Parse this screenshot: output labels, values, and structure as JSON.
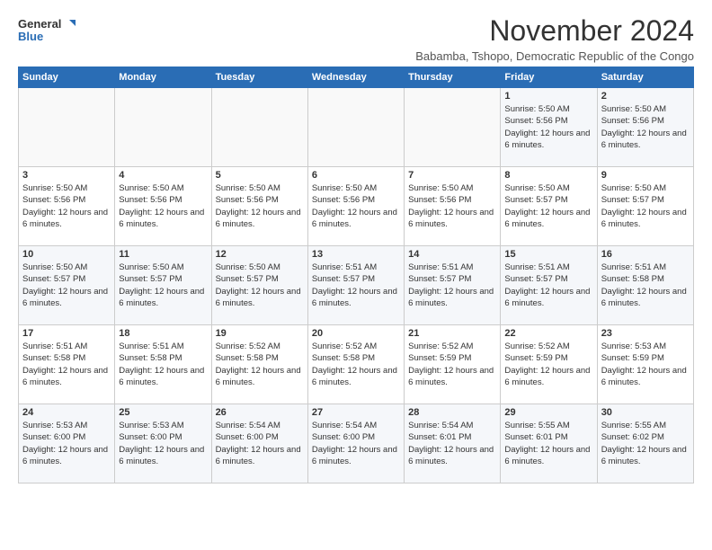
{
  "header": {
    "logo_line1": "General",
    "logo_line2": "Blue",
    "month": "November 2024",
    "location": "Babamba, Tshopo, Democratic Republic of the Congo"
  },
  "weekdays": [
    "Sunday",
    "Monday",
    "Tuesday",
    "Wednesday",
    "Thursday",
    "Friday",
    "Saturday"
  ],
  "weeks": [
    [
      {
        "day": "",
        "info": ""
      },
      {
        "day": "",
        "info": ""
      },
      {
        "day": "",
        "info": ""
      },
      {
        "day": "",
        "info": ""
      },
      {
        "day": "",
        "info": ""
      },
      {
        "day": "1",
        "info": "Sunrise: 5:50 AM\nSunset: 5:56 PM\nDaylight: 12 hours and 6 minutes."
      },
      {
        "day": "2",
        "info": "Sunrise: 5:50 AM\nSunset: 5:56 PM\nDaylight: 12 hours and 6 minutes."
      }
    ],
    [
      {
        "day": "3",
        "info": "Sunrise: 5:50 AM\nSunset: 5:56 PM\nDaylight: 12 hours and 6 minutes."
      },
      {
        "day": "4",
        "info": "Sunrise: 5:50 AM\nSunset: 5:56 PM\nDaylight: 12 hours and 6 minutes."
      },
      {
        "day": "5",
        "info": "Sunrise: 5:50 AM\nSunset: 5:56 PM\nDaylight: 12 hours and 6 minutes."
      },
      {
        "day": "6",
        "info": "Sunrise: 5:50 AM\nSunset: 5:56 PM\nDaylight: 12 hours and 6 minutes."
      },
      {
        "day": "7",
        "info": "Sunrise: 5:50 AM\nSunset: 5:56 PM\nDaylight: 12 hours and 6 minutes."
      },
      {
        "day": "8",
        "info": "Sunrise: 5:50 AM\nSunset: 5:57 PM\nDaylight: 12 hours and 6 minutes."
      },
      {
        "day": "9",
        "info": "Sunrise: 5:50 AM\nSunset: 5:57 PM\nDaylight: 12 hours and 6 minutes."
      }
    ],
    [
      {
        "day": "10",
        "info": "Sunrise: 5:50 AM\nSunset: 5:57 PM\nDaylight: 12 hours and 6 minutes."
      },
      {
        "day": "11",
        "info": "Sunrise: 5:50 AM\nSunset: 5:57 PM\nDaylight: 12 hours and 6 minutes."
      },
      {
        "day": "12",
        "info": "Sunrise: 5:50 AM\nSunset: 5:57 PM\nDaylight: 12 hours and 6 minutes."
      },
      {
        "day": "13",
        "info": "Sunrise: 5:51 AM\nSunset: 5:57 PM\nDaylight: 12 hours and 6 minutes."
      },
      {
        "day": "14",
        "info": "Sunrise: 5:51 AM\nSunset: 5:57 PM\nDaylight: 12 hours and 6 minutes."
      },
      {
        "day": "15",
        "info": "Sunrise: 5:51 AM\nSunset: 5:57 PM\nDaylight: 12 hours and 6 minutes."
      },
      {
        "day": "16",
        "info": "Sunrise: 5:51 AM\nSunset: 5:58 PM\nDaylight: 12 hours and 6 minutes."
      }
    ],
    [
      {
        "day": "17",
        "info": "Sunrise: 5:51 AM\nSunset: 5:58 PM\nDaylight: 12 hours and 6 minutes."
      },
      {
        "day": "18",
        "info": "Sunrise: 5:51 AM\nSunset: 5:58 PM\nDaylight: 12 hours and 6 minutes."
      },
      {
        "day": "19",
        "info": "Sunrise: 5:52 AM\nSunset: 5:58 PM\nDaylight: 12 hours and 6 minutes."
      },
      {
        "day": "20",
        "info": "Sunrise: 5:52 AM\nSunset: 5:58 PM\nDaylight: 12 hours and 6 minutes."
      },
      {
        "day": "21",
        "info": "Sunrise: 5:52 AM\nSunset: 5:59 PM\nDaylight: 12 hours and 6 minutes."
      },
      {
        "day": "22",
        "info": "Sunrise: 5:52 AM\nSunset: 5:59 PM\nDaylight: 12 hours and 6 minutes."
      },
      {
        "day": "23",
        "info": "Sunrise: 5:53 AM\nSunset: 5:59 PM\nDaylight: 12 hours and 6 minutes."
      }
    ],
    [
      {
        "day": "24",
        "info": "Sunrise: 5:53 AM\nSunset: 6:00 PM\nDaylight: 12 hours and 6 minutes."
      },
      {
        "day": "25",
        "info": "Sunrise: 5:53 AM\nSunset: 6:00 PM\nDaylight: 12 hours and 6 minutes."
      },
      {
        "day": "26",
        "info": "Sunrise: 5:54 AM\nSunset: 6:00 PM\nDaylight: 12 hours and 6 minutes."
      },
      {
        "day": "27",
        "info": "Sunrise: 5:54 AM\nSunset: 6:00 PM\nDaylight: 12 hours and 6 minutes."
      },
      {
        "day": "28",
        "info": "Sunrise: 5:54 AM\nSunset: 6:01 PM\nDaylight: 12 hours and 6 minutes."
      },
      {
        "day": "29",
        "info": "Sunrise: 5:55 AM\nSunset: 6:01 PM\nDaylight: 12 hours and 6 minutes."
      },
      {
        "day": "30",
        "info": "Sunrise: 5:55 AM\nSunset: 6:02 PM\nDaylight: 12 hours and 6 minutes."
      }
    ]
  ]
}
